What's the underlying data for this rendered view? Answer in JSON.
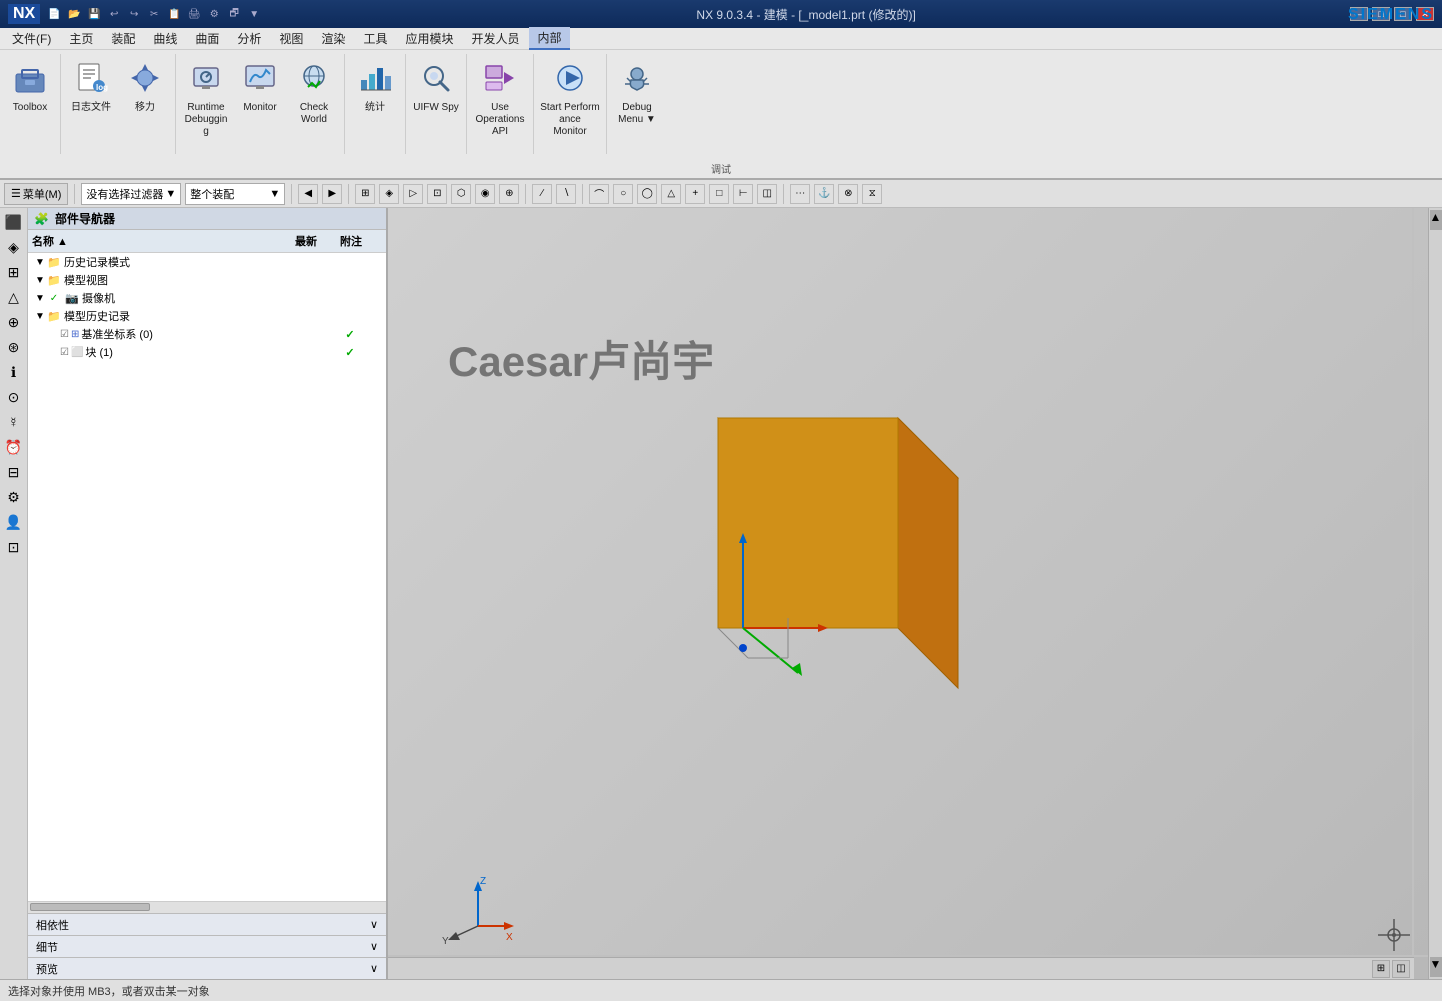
{
  "titlebar": {
    "logo": "NX",
    "title": "NX 9.0.3.4 - 建模 - [_model1.prt  (修改的)]",
    "siemens": "SIEMENS",
    "win_buttons": [
      "—",
      "□",
      "✕"
    ]
  },
  "menubar": {
    "items": [
      "文件(F)",
      "主页",
      "装配",
      "曲线",
      "曲面",
      "分析",
      "视图",
      "渲染",
      "工具",
      "应用模块",
      "开发人员",
      "内部"
    ]
  },
  "toolbar": {
    "groups": [
      {
        "id": "group1",
        "buttons": [
          {
            "id": "toolbox",
            "label": "Toolbox",
            "icon": "🧰"
          },
          {
            "id": "log",
            "label": "日志文件",
            "icon": "📄"
          },
          {
            "id": "move",
            "label": "移力",
            "icon": "↔"
          },
          {
            "id": "runtime",
            "label": "Runtime\nDebugging",
            "icon": "🔧"
          },
          {
            "id": "monitor",
            "label": "Monitor",
            "icon": "📊"
          },
          {
            "id": "checkworld",
            "label": "Check\nWorld",
            "icon": "🌐"
          },
          {
            "id": "stats",
            "label": "统计",
            "icon": "📈"
          },
          {
            "id": "uifw",
            "label": "UIFW Spy",
            "icon": "🔍"
          },
          {
            "id": "useops",
            "label": "Use\nOperations API",
            "icon": "⚙"
          },
          {
            "id": "startperf",
            "label": "Start Performance\nMonitor",
            "icon": "▶"
          },
          {
            "id": "debug",
            "label": "Debug\nMenu",
            "icon": "🐛"
          }
        ]
      }
    ],
    "adjust_label": "调试"
  },
  "toolbar2": {
    "menu_label": "菜单(M)",
    "filter_label": "没有选择过滤器",
    "assembly_label": "整个装配",
    "nav_icons": [
      "◀",
      "▶",
      "↩",
      "↪"
    ]
  },
  "nav_panel": {
    "title": "部件导航器",
    "columns": [
      "名称",
      "最新",
      "附注"
    ],
    "tree": [
      {
        "indent": 1,
        "expand": "▼",
        "icon": "📁",
        "label": "历史记录模式",
        "check": "",
        "latest": "",
        "note": ""
      },
      {
        "indent": 1,
        "expand": "▼",
        "icon": "📁",
        "label": "模型视图",
        "check": "",
        "latest": "",
        "note": ""
      },
      {
        "indent": 1,
        "expand": "▼",
        "icon": "📷",
        "label": "摄像机",
        "check": "✓",
        "latest": "",
        "note": ""
      },
      {
        "indent": 1,
        "expand": "▼",
        "icon": "📁",
        "label": "模型历史记录",
        "check": "",
        "latest": "",
        "note": ""
      },
      {
        "indent": 2,
        "expand": " ",
        "icon": "⊞",
        "label": "基准坐标系 (0)",
        "check": "✓",
        "latest": "✓",
        "note": ""
      },
      {
        "indent": 2,
        "expand": " ",
        "icon": "⬜",
        "label": "块 (1)",
        "check": "✓",
        "latest": "✓",
        "note": ""
      }
    ],
    "collapse_rows": [
      "相依性",
      "细节",
      "预览"
    ]
  },
  "viewport": {
    "watermark": "Caesar卢尚宇",
    "bg_color": "#c8c8c8",
    "box": {
      "color_top": "#e8a020",
      "color_right": "#c87010",
      "color_front": "#d89018"
    }
  },
  "statusbar": {
    "text": "选择对象并使用 MB3，或者双击某一对象"
  }
}
